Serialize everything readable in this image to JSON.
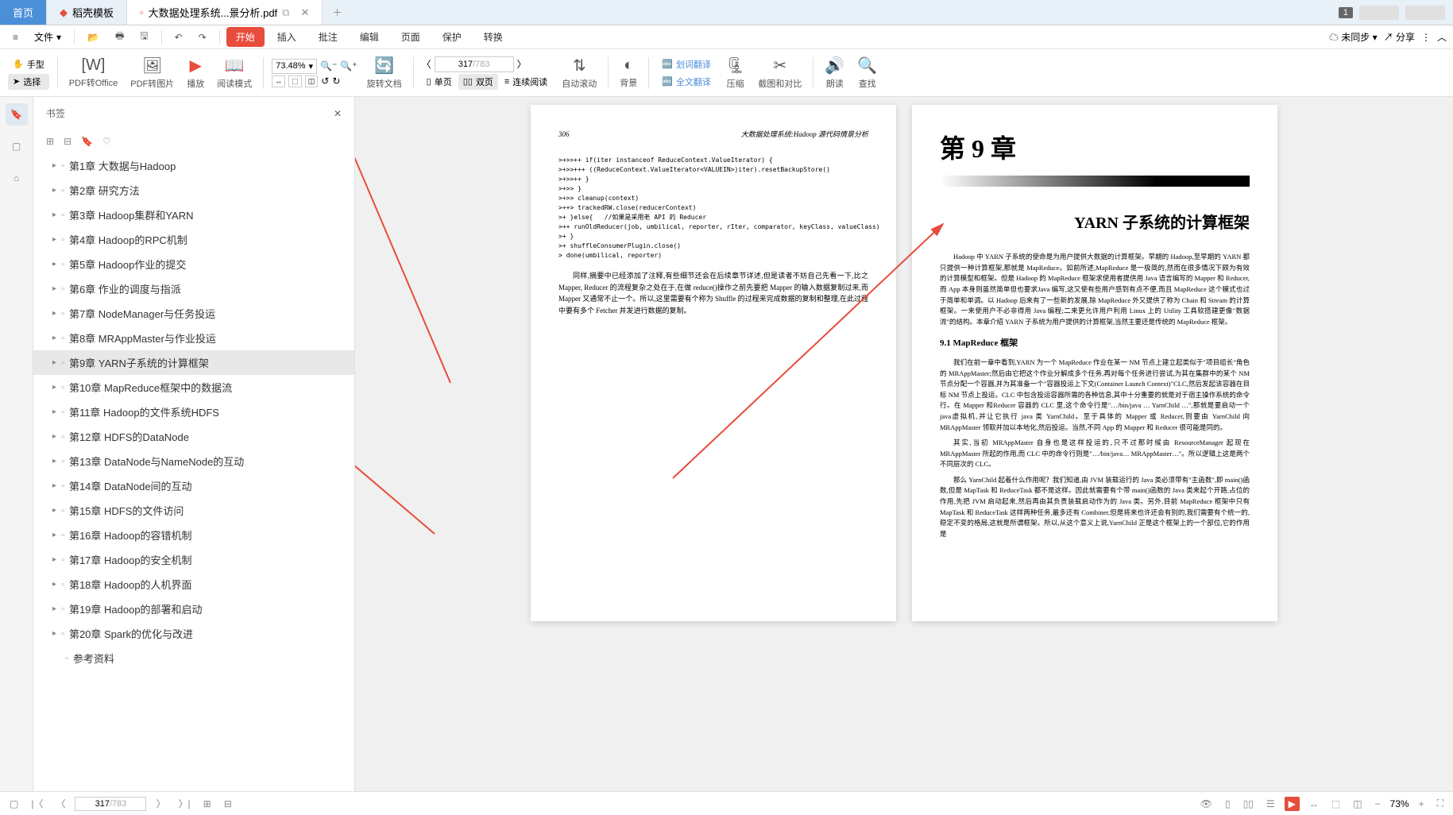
{
  "tabs": {
    "home": "首页",
    "daoke": "稻壳模板",
    "active": "大数据处理系统...景分析.pdf",
    "badge": "1"
  },
  "menubar": {
    "file": "文件",
    "items": [
      "开始",
      "插入",
      "批注",
      "编辑",
      "页面",
      "保护",
      "转换"
    ],
    "sync": "未同步",
    "share": "分享"
  },
  "toolbar": {
    "hand": "手型",
    "select": "选择",
    "pdf_office": "PDF转Office",
    "pdf_image": "PDF转图片",
    "play": "播放",
    "read_mode": "阅读模式",
    "zoom": "73.48%",
    "rotate": "旋转文档",
    "single_page": "单页",
    "double_page": "双页",
    "continuous": "连续阅读",
    "current_page": "317",
    "total_pages": "/783",
    "auto_scroll": "自动滚动",
    "background": "背景",
    "word_translate": "划词翻译",
    "full_translate": "全文翻译",
    "compress": "压缩",
    "screenshot": "截图和对比",
    "read_aloud": "朗读",
    "find": "查找"
  },
  "sidebar": {
    "title": "书签",
    "items": [
      "第1章  大数据与Hadoop",
      "第2章  研究方法",
      "第3章  Hadoop集群和YARN",
      "第4章  Hadoop的RPC机制",
      "第5章  Hadoop作业的提交",
      "第6章  作业的调度与指派",
      "第7章  NodeManager与任务投运",
      "第8章  MRAppMaster与作业投运",
      "第9章  YARN子系统的计算框架",
      "第10章  MapReduce框架中的数据流",
      "第11章  Hadoop的文件系统HDFS",
      "第12章  HDFS的DataNode",
      "第13章  DataNode与NameNode的互动",
      "第14章  DataNode间的互动",
      "第15章  HDFS的文件访问",
      "第16章  Hadoop的容错机制",
      "第17章  Hadoop的安全机制",
      "第18章  Hadoop的人机界面",
      "第19章  Hadoop的部署和启动",
      "第20章  Spark的优化与改进",
      "参考资料"
    ],
    "active_index": 8
  },
  "page_left": {
    "number": "306",
    "header": "大数据处理系统:Hadoop 源代码情景分析",
    "code": ">+>>++ if(iter instanceof ReduceContext.ValueIterator) {\n>+>>+++ ((ReduceContext.ValueIterator<VALUEIN>)iter).resetBackupStore()\n>+>>++ }\n>+>> }\n>+>> cleanup(context)\n>++> trackedRW.close(reducerContext)\n>+ }else{   //如果是采用老 API 的 Reducer\n>++ runOldReducer(job, umbilical, reporter, rIter, comparator, keyClass, valueClass)\n>+ }\n>+ shuffleConsumerPlugin.close()\n> done(umbilical, reporter)",
    "para1": "同样,摘要中已经添加了注释,有些细节还会在后续章节详述,但是读者不妨自己先看一下,比之 Mapper, Reducer 的流程复杂之处在于,在做 reduce()操作之前先要把 Mapper 的输入数据复制过来,而 Mapper 又通常不止一个。所以,这里需要有个称为 Shuffle 的过程来完成数据的复制和整理,在此过程中要有多个 Fetcher 并发进行数据的复制。"
  },
  "page_right": {
    "chapter": "第 9 章",
    "title": "YARN 子系统的计算框架",
    "para1": "Hadoop 中 YARN 子系统的使命是为用户提供大数据的计算框架。早期的 Hadoop,至早期的 YARN 都只提供一种计算框架,那就是 MapReduce。如前所述,MapReduce 是一极简的,然而在很多情况下颇为有效的计算模型和框架。但是 Hadoop 的 MapReduce 框架求使用者提供用 Java 语言编写的 Mapper 和 Reducer,而 App 本身则虽然简单但也要求Java 编写,这又使有些用户感到有点不便,而且 MapReduce 这个模式也过于简单和单调。以 Hadoop 后来有了一些新的发展,除 MapReduce 外又提供了称为 Chain 和 Stream 的计算框架。一来使用户不必非得用 Java 编程;二来更允许用户利用 Linux 上的 Utility 工具软搭建更像\"数据流\"的结构。本章介绍 YARN 子系统为用户提供的计算框架,当然主要还是传统的 MapReduce 框架。",
    "section": "9.1  MapReduce 框架",
    "para2": "我们在前一章中看到,YARN 为一个 MapReduce 作业在某一 NM 节点上建立起类似于\"项目组长\"角色的 MRAppMaster;然后由它把这个作业分解成多个任务,再对每个任务进行尝试,为其在集群中的某个 NM 节点分配一个容器,并为其准备一个\"容器投运上下文(Container Launch Context)\"CLC,然后发起该容器在目标 NM 节点上投运。CLC 中包含投运容器所需的各种信息,其中十分重要的就是对于宿主操作系统的命令行。在 Mapper 和Reducer 容器的 CLC 里,这个命令行是\"…/bin/java … YarnChild …\",那就是要启动一个 java虚拟机,并让它执行 java 类 YarnChild。至于具体的 Mapper 或 Reducer,则要由 YarnChild 向MRAppMaster 领取并加以本地化,然后投运。当然,不同 App 的 Mapper 和 Reducer 很可能是同的。",
    "para3": "其实,当初 MRAppMaster 自身也是这样投运的,只不过那时候由 ResourceManager 起现在 MRAppMaster 所起的作用,而 CLC 中的命令行则是\"…/bin/java… MRAppMaster…\"。所以逻辑上这是两个不同层次的 CLC。",
    "para4": "那么 YarnChild 起着什么作用呢？我们知道,由 JVM 装载运行的 Java 类必须带有\"主函数\",即 main()函数,但是 MapTask 和 ReduceTask 都不是这样。因此就需要有个带 main()函数的 Java 类来起个开路,占位的作用,先把 JVM 启动起来,然后再由其负责装载启动作为的 Java 类。另外,目前 MapReduce 框架中只有 MapTask 和 ReduceTask 这样两种任务,最多还有 Combiner,但是将来也许还会有别的,我们需要有个统一的,稳定不变的格局,这就是所谓框架。所以,从这个意义上说,YarnChild 正是这个框架上的一个部位,它的作用是"
  },
  "statusbar": {
    "current_page": "317",
    "total_pages": "/783",
    "zoom": "73%"
  }
}
